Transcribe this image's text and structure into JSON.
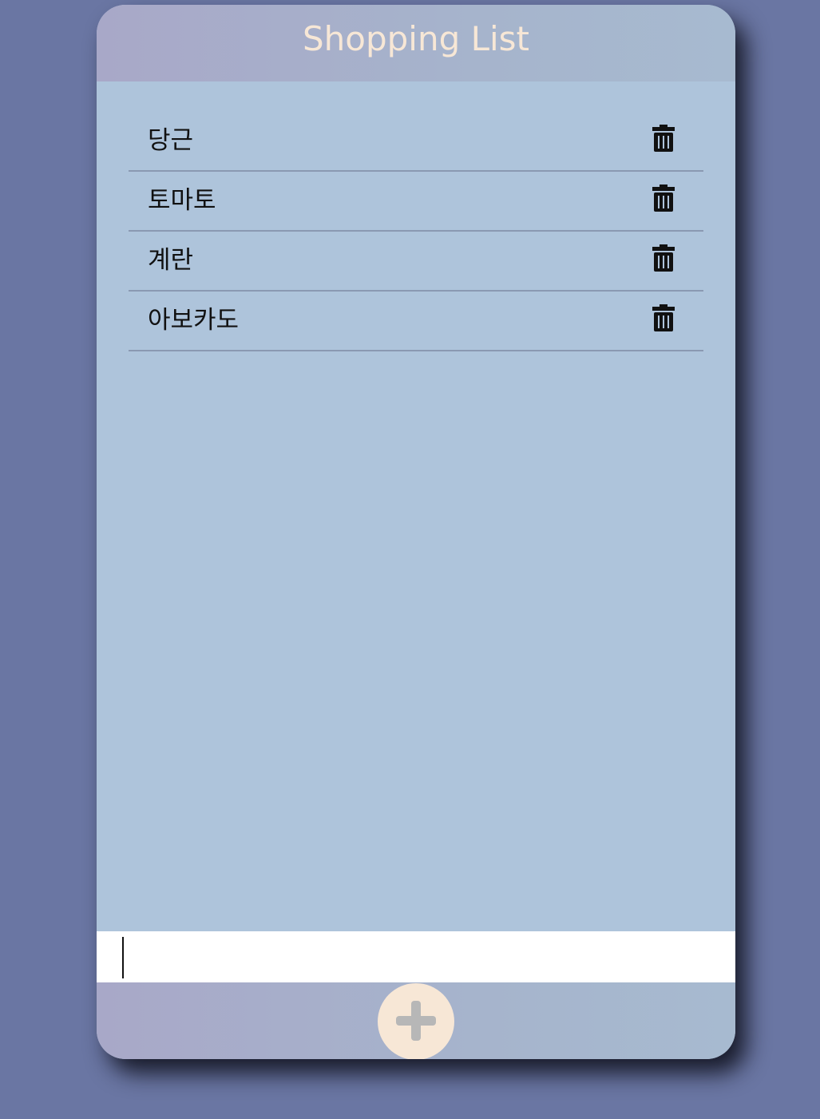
{
  "header": {
    "title": "Shopping List"
  },
  "items": [
    {
      "label": "당근",
      "delete_icon": "trash-icon"
    },
    {
      "label": "토마토",
      "delete_icon": "trash-icon"
    },
    {
      "label": "계란",
      "delete_icon": "trash-icon"
    },
    {
      "label": "아보카도",
      "delete_icon": "trash-icon"
    }
  ],
  "input": {
    "value": "",
    "placeholder": ""
  },
  "footer": {
    "add_icon": "plus-icon"
  },
  "colors": {
    "background": "#6a76a3",
    "panel": "#aec4db",
    "title_text": "#f7e7d6",
    "add_button": "#f7e7d6"
  }
}
